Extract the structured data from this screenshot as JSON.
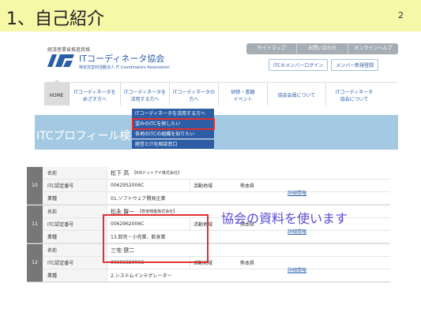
{
  "slide": {
    "title": "1、自己紹介",
    "number": "2"
  },
  "site": {
    "cert_line": "経済産業省推進資格",
    "logo_name": "ITコーディネータ協会",
    "logo_sub": "特定非営利活動法人 IT Coordinators Association",
    "utility_links": [
      "サイトマップ",
      "お問い合わせ",
      "オンラインヘルプ"
    ],
    "login_link": "ITC®メンバーログイン",
    "register_link": "メンバー新規登録"
  },
  "nav": {
    "home": "HOME",
    "items": [
      "ITコーディネータを めざす方へ",
      "ITコーディネータを 活用する方へ",
      "ITコーディネータの 方へ",
      "研修・書籍 イベント",
      "協会会員について",
      "ITコーディネータ 協会について"
    ]
  },
  "dropdown": [
    "ITコーディネータを活用する方へ",
    "望みのITCを探したい",
    "各地のITCの組織を知りたい",
    "経営とIT化相談窓口"
  ],
  "banner": {
    "text": "ITCプロフィール検"
  },
  "table": {
    "labels": {
      "name": "名前",
      "cert": "ITC認定番号",
      "industry": "業種",
      "area": "活動地域",
      "detail": "詳細情報"
    },
    "records": [
      {
        "index": "10",
        "name": "松下 高",
        "company": "【KISドットアイ株式会社】",
        "cert": "0062952006C",
        "area": "熊本県",
        "industry": "01.ソフトウェア開発企業"
      },
      {
        "index": "11",
        "name": "松永 賢一",
        "company": "【若後物産株式会社】",
        "cert": "0062962006C",
        "area": "熊本県",
        "industry": "13.卸売・小売業、飲食業"
      },
      {
        "index": "12",
        "name": "三宅 健二",
        "company": "",
        "cert": "0069332006C",
        "area": "熊本県",
        "industry": "2.システムインテグレーター"
      }
    ]
  },
  "annotation": "協会の資料を使います",
  "colors": {
    "title_bar": "#f7f7a8",
    "brand_blue": "#2a5ea5",
    "highlight_red": "#e02f2f",
    "annotation": "#5b4bd6"
  }
}
